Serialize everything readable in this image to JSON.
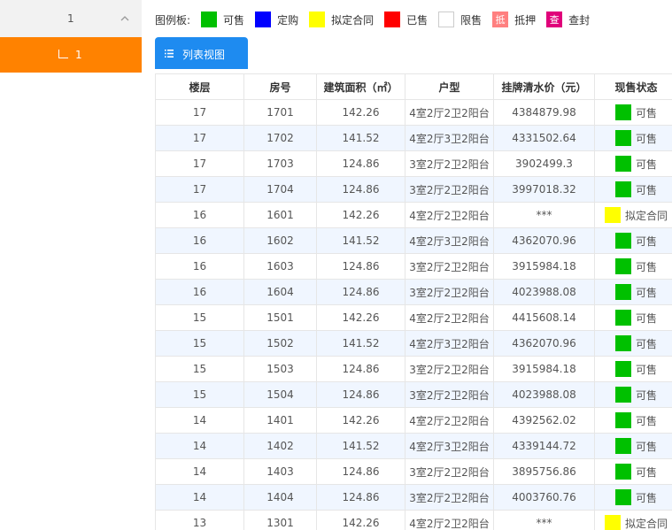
{
  "sidebar": {
    "header_label": "1",
    "selected_item_label": "1"
  },
  "legend": {
    "title": "图例板:",
    "items": [
      {
        "label": "可售",
        "color": "#00c000"
      },
      {
        "label": "定购",
        "color": "#0000ff"
      },
      {
        "label": "拟定合同",
        "color": "#ffff00"
      },
      {
        "label": "已售",
        "color": "#ff0000"
      },
      {
        "label": "限售",
        "color": "#ffffff"
      },
      {
        "label": "抵押",
        "color": "#ff8080",
        "icon_text": "抵"
      },
      {
        "label": "查封",
        "color": "#e0007a",
        "icon_text": "查"
      }
    ]
  },
  "tab": {
    "label": "列表视图"
  },
  "table": {
    "headers": [
      "楼层",
      "房号",
      "建筑面积（㎡）",
      "户型",
      "挂牌清水价（元）",
      "现售状态"
    ],
    "rows": [
      {
        "floor": "17",
        "room": "1701",
        "area": "142.26",
        "type": "4室2厅2卫2阳台",
        "price": "4384879.98",
        "status": "可售",
        "status_color": "#00c000"
      },
      {
        "floor": "17",
        "room": "1702",
        "area": "141.52",
        "type": "4室2厅3卫2阳台",
        "price": "4331502.64",
        "status": "可售",
        "status_color": "#00c000"
      },
      {
        "floor": "17",
        "room": "1703",
        "area": "124.86",
        "type": "3室2厅2卫2阳台",
        "price": "3902499.3",
        "status": "可售",
        "status_color": "#00c000"
      },
      {
        "floor": "17",
        "room": "1704",
        "area": "124.86",
        "type": "3室2厅2卫2阳台",
        "price": "3997018.32",
        "status": "可售",
        "status_color": "#00c000"
      },
      {
        "floor": "16",
        "room": "1601",
        "area": "142.26",
        "type": "4室2厅2卫2阳台",
        "price": "***",
        "status": "拟定合同",
        "status_color": "#ffff00"
      },
      {
        "floor": "16",
        "room": "1602",
        "area": "141.52",
        "type": "4室2厅3卫2阳台",
        "price": "4362070.96",
        "status": "可售",
        "status_color": "#00c000"
      },
      {
        "floor": "16",
        "room": "1603",
        "area": "124.86",
        "type": "3室2厅2卫2阳台",
        "price": "3915984.18",
        "status": "可售",
        "status_color": "#00c000"
      },
      {
        "floor": "16",
        "room": "1604",
        "area": "124.86",
        "type": "3室2厅2卫2阳台",
        "price": "4023988.08",
        "status": "可售",
        "status_color": "#00c000"
      },
      {
        "floor": "15",
        "room": "1501",
        "area": "142.26",
        "type": "4室2厅2卫2阳台",
        "price": "4415608.14",
        "status": "可售",
        "status_color": "#00c000"
      },
      {
        "floor": "15",
        "room": "1502",
        "area": "141.52",
        "type": "4室2厅3卫2阳台",
        "price": "4362070.96",
        "status": "可售",
        "status_color": "#00c000"
      },
      {
        "floor": "15",
        "room": "1503",
        "area": "124.86",
        "type": "3室2厅2卫2阳台",
        "price": "3915984.18",
        "status": "可售",
        "status_color": "#00c000"
      },
      {
        "floor": "15",
        "room": "1504",
        "area": "124.86",
        "type": "3室2厅2卫2阳台",
        "price": "4023988.08",
        "status": "可售",
        "status_color": "#00c000"
      },
      {
        "floor": "14",
        "room": "1401",
        "area": "142.26",
        "type": "4室2厅2卫2阳台",
        "price": "4392562.02",
        "status": "可售",
        "status_color": "#00c000"
      },
      {
        "floor": "14",
        "room": "1402",
        "area": "141.52",
        "type": "4室2厅3卫2阳台",
        "price": "4339144.72",
        "status": "可售",
        "status_color": "#00c000"
      },
      {
        "floor": "14",
        "room": "1403",
        "area": "124.86",
        "type": "3室2厅2卫2阳台",
        "price": "3895756.86",
        "status": "可售",
        "status_color": "#00c000"
      },
      {
        "floor": "14",
        "room": "1404",
        "area": "124.86",
        "type": "3室2厅2卫2阳台",
        "price": "4003760.76",
        "status": "可售",
        "status_color": "#00c000"
      },
      {
        "floor": "13",
        "room": "1301",
        "area": "142.26",
        "type": "4室2厅2卫2阳台",
        "price": "***",
        "status": "拟定合同",
        "status_color": "#ffff00"
      }
    ]
  }
}
